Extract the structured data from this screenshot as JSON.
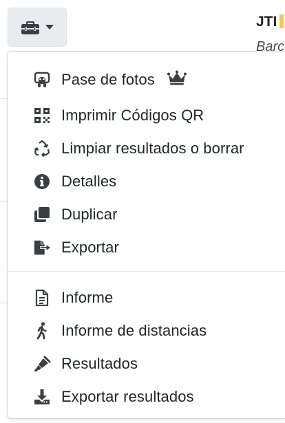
{
  "background": {
    "title": "JTI",
    "subtitle": "Barc"
  },
  "toolbar": {
    "toggle_icon": "toolbox-icon",
    "caret_icon": "caret-down-icon"
  },
  "menu": {
    "group1": [
      {
        "label": "Pase de fotos",
        "icon": "slideshow-icon",
        "badge_icon": "crown-icon"
      },
      {
        "label": "Imprimir Códigos QR",
        "icon": "qr-code-icon"
      },
      {
        "label": "Limpiar resultados o borrar",
        "icon": "recycle-icon"
      },
      {
        "label": "Detalles",
        "icon": "info-circle-icon"
      },
      {
        "label": "Duplicar",
        "icon": "copy-icon"
      },
      {
        "label": "Exportar",
        "icon": "file-export-icon"
      }
    ],
    "group2": [
      {
        "label": "Informe",
        "icon": "file-report-icon"
      },
      {
        "label": "Informe de distancias",
        "icon": "walking-icon"
      },
      {
        "label": "Resultados",
        "icon": "highlighter-icon"
      },
      {
        "label": "Exportar resultados",
        "icon": "download-icon"
      }
    ]
  }
}
